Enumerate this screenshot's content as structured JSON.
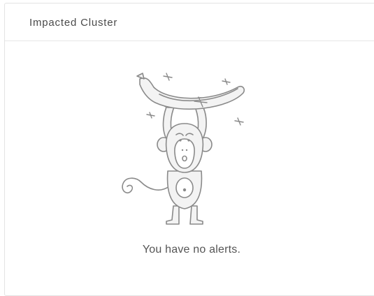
{
  "panel": {
    "title": "Impacted Cluster"
  },
  "empty_state": {
    "illustration": "monkey-holding-banana-icon",
    "message": "You have no alerts."
  },
  "colors": {
    "stroke": "#8a8a8a",
    "fill": "#f3f3f3",
    "title_text": "#4a4a4a",
    "message_text": "#555555",
    "divider": "#e6e6e6"
  }
}
